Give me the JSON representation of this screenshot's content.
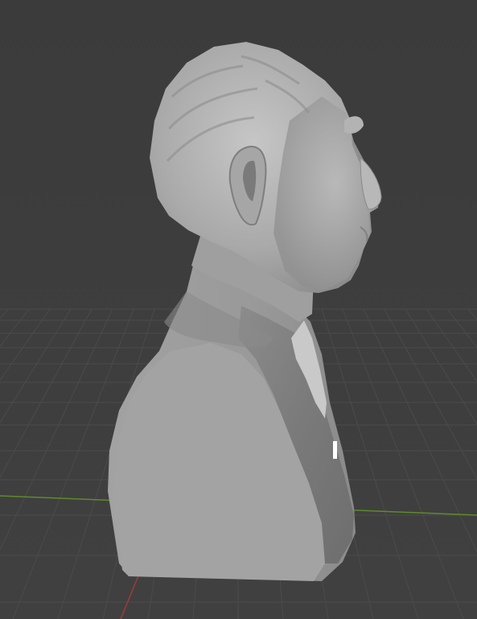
{
  "viewport": {
    "background_color": "#3d3d3d",
    "grid_line_color": "#4a4a4a",
    "x_axis_color": "#5f8a2c",
    "y_axis_color": "#9c3b3b",
    "model_base_color": "#9a9a9a",
    "model_shadow_color": "#6a6a6a",
    "model_highlight_color": "#c4c4c4"
  },
  "model": {
    "name": "bust-sculpture",
    "view": "right-side-profile"
  }
}
